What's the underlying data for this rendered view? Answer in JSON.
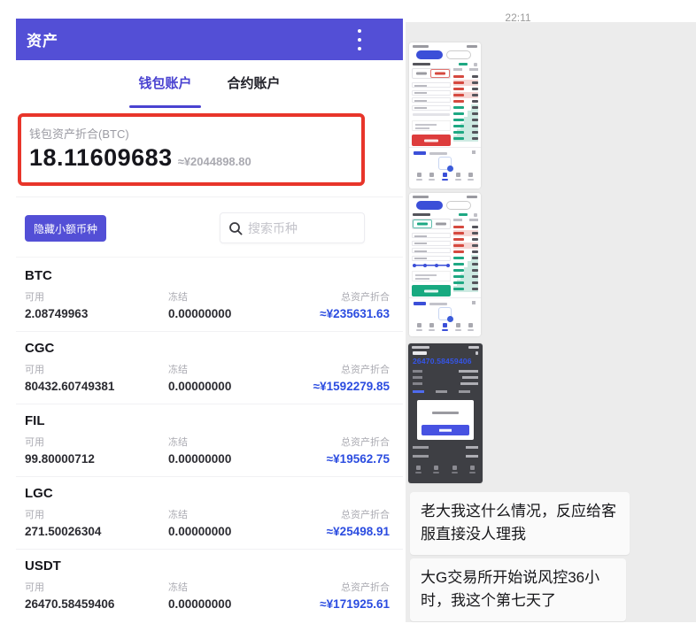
{
  "left_app": {
    "header": {
      "title": "资产",
      "menu_icon": "kebab-menu-icon"
    },
    "tabs": [
      {
        "label": "钱包账户",
        "active": true
      },
      {
        "label": "合约账户",
        "active": false
      }
    ],
    "summary": {
      "label": "钱包资产折合(BTC)",
      "amount": "18.11609683",
      "fiat": "≈¥2044898.80"
    },
    "hide_small_button": "隐藏小额币种",
    "search": {
      "placeholder": "搜索币种",
      "icon": "search-icon"
    },
    "columns": {
      "available": "可用",
      "frozen": "冻结",
      "total": "总资产折合"
    },
    "coins": [
      {
        "symbol": "BTC",
        "available": "2.08749963",
        "frozen": "0.00000000",
        "total": "≈¥235631.63"
      },
      {
        "symbol": "CGC",
        "available": "80432.60749381",
        "frozen": "0.00000000",
        "total": "≈¥1592279.85"
      },
      {
        "symbol": "FIL",
        "available": "99.80000712",
        "frozen": "0.00000000",
        "total": "≈¥19562.75"
      },
      {
        "symbol": "LGC",
        "available": "271.50026304",
        "frozen": "0.00000000",
        "total": "≈¥25498.91"
      },
      {
        "symbol": "USDT",
        "available": "26470.58459406",
        "frozen": "0.00000000",
        "total": "≈¥171925.61"
      }
    ]
  },
  "chat": {
    "timestamp": "22:11",
    "attachments": [
      {
        "kind": "screenshot-thumbnail",
        "subject": "trading-sell-screen"
      },
      {
        "kind": "screenshot-thumbnail",
        "subject": "trading-buy-screen"
      },
      {
        "kind": "screenshot-thumbnail",
        "subject": "dark-balance-dialog",
        "visible_number": "26470.58459406"
      }
    ],
    "messages": [
      "老大我这什么情况，反应给客服直接没人理我",
      "大G交易所开始说风控36小时，我这个第七天了"
    ]
  },
  "colors": {
    "accent_purple": "#534fd6",
    "highlight_red": "#e8352a",
    "value_blue": "#2b4ce0",
    "buy_green": "#18a980",
    "sell_red": "#dd3c3c",
    "chat_background": "#ececec"
  }
}
